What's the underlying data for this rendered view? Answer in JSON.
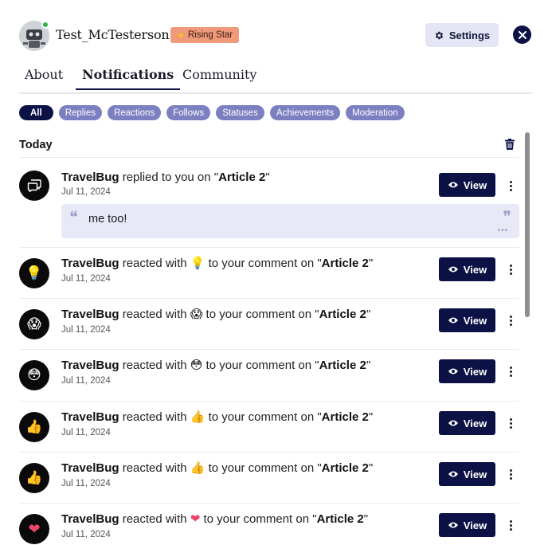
{
  "profile": {
    "username": "Test_McTesterson",
    "badge_label": "Rising Star",
    "badge_icon": "star-icon",
    "online": true
  },
  "header": {
    "settings_label": "Settings",
    "settings_icon": "gear-icon",
    "close_icon": "close-icon"
  },
  "tabs": [
    {
      "label": "About",
      "active": false
    },
    {
      "label": "Notifications",
      "active": true
    },
    {
      "label": "Community",
      "active": false
    }
  ],
  "filters": [
    {
      "label": "All",
      "active": true
    },
    {
      "label": "Replies",
      "active": false
    },
    {
      "label": "Reactions",
      "active": false
    },
    {
      "label": "Follows",
      "active": false
    },
    {
      "label": "Statuses",
      "active": false
    },
    {
      "label": "Achievements",
      "active": false
    },
    {
      "label": "Moderation",
      "active": false
    }
  ],
  "section": {
    "title": "Today",
    "trash_icon": "trash-icon"
  },
  "notifications": [
    {
      "icon": "speech-bubbles-icon",
      "actor": "TravelBug",
      "action": " replied to you on \"",
      "emoji": "",
      "target": "Article 2",
      "suffix": "\"",
      "date": "Jul 11, 2024",
      "quote": "me too!",
      "view_label": "View"
    },
    {
      "icon": "lightbulb-icon",
      "icon_glyph": "💡",
      "actor": "TravelBug",
      "action": " reacted with ",
      "emoji": "💡",
      "mid": " to your comment on \"",
      "target": "Article 2",
      "suffix": "\"",
      "date": "Jul 11, 2024",
      "view_label": "View"
    },
    {
      "icon": "shocked-face-icon",
      "icon_glyph": "😱",
      "actor": "TravelBug",
      "action": " reacted with ",
      "emoji": "😱",
      "mid": " to your comment on \"",
      "target": "Article 2",
      "suffix": "\"",
      "date": "Jul 11, 2024",
      "view_label": "View"
    },
    {
      "icon": "flushed-face-icon",
      "icon_glyph": "😳",
      "actor": "TravelBug",
      "action": " reacted with ",
      "emoji": "😳",
      "mid": " to your comment on \"",
      "target": "Article 2",
      "suffix": "\"",
      "date": "Jul 11, 2024",
      "view_label": "View"
    },
    {
      "icon": "thumbs-up-icon",
      "icon_glyph": "👍",
      "actor": "TravelBug",
      "action": " reacted with ",
      "emoji": "👍",
      "mid": " to your comment on \"",
      "target": "Article 2",
      "suffix": "\"",
      "date": "Jul 11, 2024",
      "view_label": "View"
    },
    {
      "icon": "thumbs-up-icon",
      "icon_glyph": "👍",
      "actor": "TravelBug",
      "action": " reacted with ",
      "emoji": "👍",
      "mid": " to your comment on \"",
      "target": "Article 2",
      "suffix": "\"",
      "date": "Jul 11, 2024",
      "view_label": "View"
    },
    {
      "icon": "heart-icon",
      "icon_glyph": "❤",
      "actor": "TravelBug",
      "action": " reacted with ",
      "emoji": "❤",
      "mid": " to your comment on \"",
      "target": "Article 2",
      "suffix": "\"",
      "date": "Jul 11, 2024",
      "view_label": "View"
    }
  ],
  "colors": {
    "primary": "#0c1246",
    "chip": "#7c7fc0",
    "badge": "#ef9a7a",
    "quote_bg": "#e8e9f7",
    "online": "#2fb344",
    "heart": "#e8456b"
  }
}
